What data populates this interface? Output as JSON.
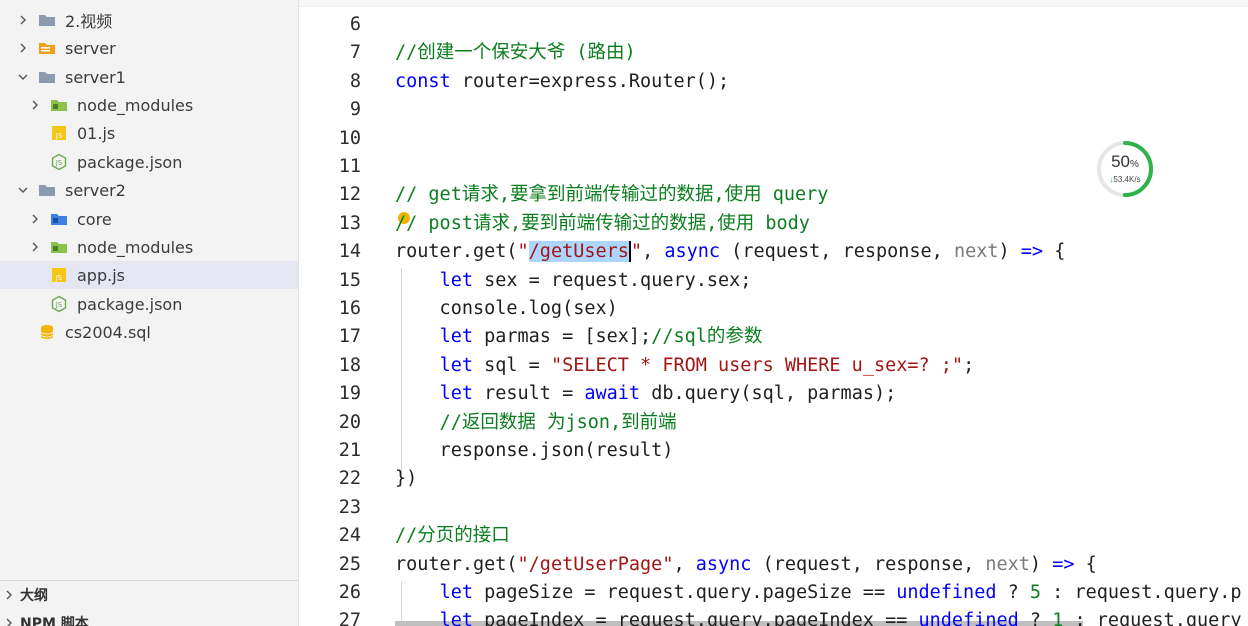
{
  "sidebar": {
    "items": [
      {
        "label": "2.视频",
        "type": "folder-collapsed",
        "icon": "folder-icon"
      },
      {
        "label": "server",
        "type": "folder-collapsed",
        "icon": "folder-config-icon"
      },
      {
        "label": "server1",
        "type": "folder-expanded",
        "icon": "folder-icon"
      },
      {
        "label": "node_modules",
        "type": "folder-collapsed",
        "icon": "folder-node-icon"
      },
      {
        "label": "01.js",
        "type": "file",
        "icon": "js-file-icon"
      },
      {
        "label": "package.json",
        "type": "file",
        "icon": "nodejs-file-icon"
      },
      {
        "label": "server2",
        "type": "folder-expanded",
        "icon": "folder-icon"
      },
      {
        "label": "core",
        "type": "folder-collapsed",
        "icon": "folder-core-icon"
      },
      {
        "label": "node_modules",
        "type": "folder-collapsed",
        "icon": "folder-node-icon"
      },
      {
        "label": "app.js",
        "type": "file",
        "icon": "js-file-icon",
        "selected": true
      },
      {
        "label": "package.json",
        "type": "file",
        "icon": "nodejs-file-icon"
      },
      {
        "label": "cs2004.sql",
        "type": "file",
        "icon": "database-file-icon"
      }
    ],
    "panels": [
      {
        "label": "大纲"
      },
      {
        "label": "NPM 脚本"
      }
    ]
  },
  "editor": {
    "lines": [
      {
        "num": "6",
        "tokens": []
      },
      {
        "num": "7",
        "tokens": [
          {
            "t": "//创建一个保安大爷 (路由)",
            "c": "cmt"
          }
        ]
      },
      {
        "num": "8",
        "tokens": [
          {
            "t": "const",
            "c": "kw"
          },
          {
            "t": " router=express.Router();",
            "c": ""
          }
        ]
      },
      {
        "num": "9",
        "tokens": []
      },
      {
        "num": "10",
        "tokens": []
      },
      {
        "num": "11",
        "tokens": []
      },
      {
        "num": "12",
        "tokens": [
          {
            "t": "// get请求,要拿到前端传输过的数据,使用 query",
            "c": "cmt"
          }
        ]
      },
      {
        "num": "13",
        "tokens": [
          {
            "t": "// post请求,要到前端传输过的数据,使用 body",
            "c": "cmt"
          }
        ]
      },
      {
        "num": "14",
        "tokens": [
          {
            "t": "router.get(",
            "c": ""
          },
          {
            "t": "\"",
            "c": "str"
          },
          {
            "t": "/getUsers",
            "c": "str sel"
          },
          {
            "t": "\"",
            "c": "str cursor-before"
          },
          {
            "t": ", ",
            "c": ""
          },
          {
            "t": "async",
            "c": "kw"
          },
          {
            "t": " (request, response, ",
            "c": ""
          },
          {
            "t": "next",
            "c": "fade"
          },
          {
            "t": ") ",
            "c": ""
          },
          {
            "t": "=>",
            "c": "kw"
          },
          {
            "t": " {",
            "c": ""
          }
        ]
      },
      {
        "num": "15",
        "tokens": [
          {
            "t": "    ",
            "c": ""
          },
          {
            "t": "let",
            "c": "kw"
          },
          {
            "t": " sex = request.query.sex;",
            "c": ""
          }
        ]
      },
      {
        "num": "16",
        "tokens": [
          {
            "t": "    console.log(sex)",
            "c": ""
          }
        ]
      },
      {
        "num": "17",
        "tokens": [
          {
            "t": "    ",
            "c": ""
          },
          {
            "t": "let",
            "c": "kw"
          },
          {
            "t": " parmas = [sex];",
            "c": ""
          },
          {
            "t": "//sql的参数",
            "c": "cmt"
          }
        ]
      },
      {
        "num": "18",
        "tokens": [
          {
            "t": "    ",
            "c": ""
          },
          {
            "t": "let",
            "c": "kw"
          },
          {
            "t": " sql = ",
            "c": ""
          },
          {
            "t": "\"SELECT * FROM users WHERE u_sex=? ;\"",
            "c": "str"
          },
          {
            "t": ";",
            "c": ""
          }
        ]
      },
      {
        "num": "19",
        "tokens": [
          {
            "t": "    ",
            "c": ""
          },
          {
            "t": "let",
            "c": "kw"
          },
          {
            "t": " result = ",
            "c": ""
          },
          {
            "t": "await",
            "c": "kw"
          },
          {
            "t": " db.query(sql, parmas);",
            "c": ""
          }
        ]
      },
      {
        "num": "20",
        "tokens": [
          {
            "t": "    ",
            "c": ""
          },
          {
            "t": "//返回数据 为json,到前端",
            "c": "cmt"
          }
        ]
      },
      {
        "num": "21",
        "tokens": [
          {
            "t": "    response.json(result)",
            "c": ""
          }
        ]
      },
      {
        "num": "22",
        "tokens": [
          {
            "t": "})",
            "c": ""
          }
        ]
      },
      {
        "num": "23",
        "tokens": []
      },
      {
        "num": "24",
        "tokens": [
          {
            "t": "//分页的接口",
            "c": "cmt"
          }
        ]
      },
      {
        "num": "25",
        "tokens": [
          {
            "t": "router.get(",
            "c": ""
          },
          {
            "t": "\"/getUserPage\"",
            "c": "str"
          },
          {
            "t": ", ",
            "c": ""
          },
          {
            "t": "async",
            "c": "kw"
          },
          {
            "t": " (request, response, ",
            "c": ""
          },
          {
            "t": "next",
            "c": "fade"
          },
          {
            "t": ") ",
            "c": ""
          },
          {
            "t": "=>",
            "c": "kw"
          },
          {
            "t": " {",
            "c": ""
          }
        ]
      },
      {
        "num": "26",
        "tokens": [
          {
            "t": "    ",
            "c": ""
          },
          {
            "t": "let",
            "c": "kw"
          },
          {
            "t": " pageSize = request.query.pageSize == ",
            "c": ""
          },
          {
            "t": "undefined",
            "c": "kw"
          },
          {
            "t": " ? ",
            "c": ""
          },
          {
            "t": "5",
            "c": "cmt"
          },
          {
            "t": " : request.query.p",
            "c": ""
          }
        ]
      },
      {
        "num": "27",
        "tokens": [
          {
            "t": "    ",
            "c": ""
          },
          {
            "t": "let",
            "c": "kw"
          },
          {
            "t": " pageIndex = request.query.pageIndex == ",
            "c": ""
          },
          {
            "t": "undefined",
            "c": "kw"
          },
          {
            "t": " ? ",
            "c": ""
          },
          {
            "t": "1",
            "c": "cmt"
          },
          {
            "t": " : request.query",
            "c": ""
          }
        ]
      }
    ]
  },
  "speed_widget": {
    "percent": "50",
    "percent_unit": "%",
    "rate": "53.4K/s",
    "progress": 0.5,
    "ring_color": "#2fb24a"
  }
}
